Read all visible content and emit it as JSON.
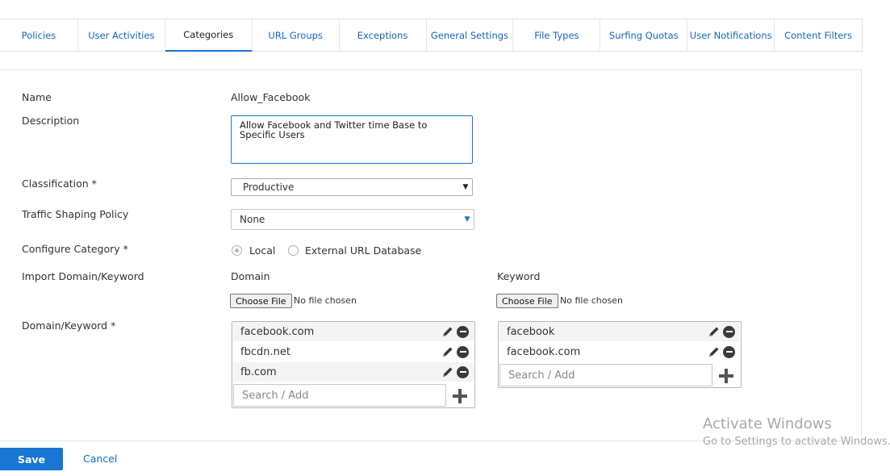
{
  "tabs": [
    {
      "label": "Policies",
      "active": false
    },
    {
      "label": "User Activities",
      "active": false
    },
    {
      "label": "Categories",
      "active": true
    },
    {
      "label": "URL Groups",
      "active": false
    },
    {
      "label": "Exceptions",
      "active": false
    },
    {
      "label": "General Settings",
      "active": false
    },
    {
      "label": "File Types",
      "active": false
    },
    {
      "label": "Surfing Quotas",
      "active": false
    },
    {
      "label": "User Notifications",
      "active": false
    },
    {
      "label": "Content Filters",
      "active": false
    }
  ],
  "form": {
    "name_label": "Name",
    "name_value": "Allow_Facebook",
    "description_label": "Description",
    "description_value": "Allow Facebook and Twitter time Base to Specific Users",
    "classification_label": "Classification *",
    "classification_value": "Productive",
    "traffic_label": "Traffic Shaping Policy",
    "traffic_value": "None",
    "configure_label": "Configure Category *",
    "configure_options": [
      "Local",
      "External URL Database"
    ],
    "configure_selected": "Local",
    "import_label": "Import Domain/Keyword",
    "domain_heading": "Domain",
    "keyword_heading": "Keyword",
    "choose_file_label": "Choose File",
    "no_file_text": "No file chosen",
    "domain_keyword_label": "Domain/Keyword *",
    "domains": [
      "facebook.com",
      "fbcdn.net",
      "fb.com"
    ],
    "keywords": [
      "facebook",
      "facebook.com"
    ],
    "search_placeholder": "Search / Add"
  },
  "footer": {
    "save_label": "Save",
    "cancel_label": "Cancel"
  },
  "watermark": {
    "line1": "Activate Windows",
    "line2": "Go to Settings to activate Windows."
  },
  "colors": {
    "accent": "#1976d2",
    "link": "#1565c0"
  },
  "icons": {
    "edit": "pencil-icon",
    "remove": "minus-circle-icon",
    "add": "plus-icon",
    "dropdown": "chevron-down-icon"
  }
}
